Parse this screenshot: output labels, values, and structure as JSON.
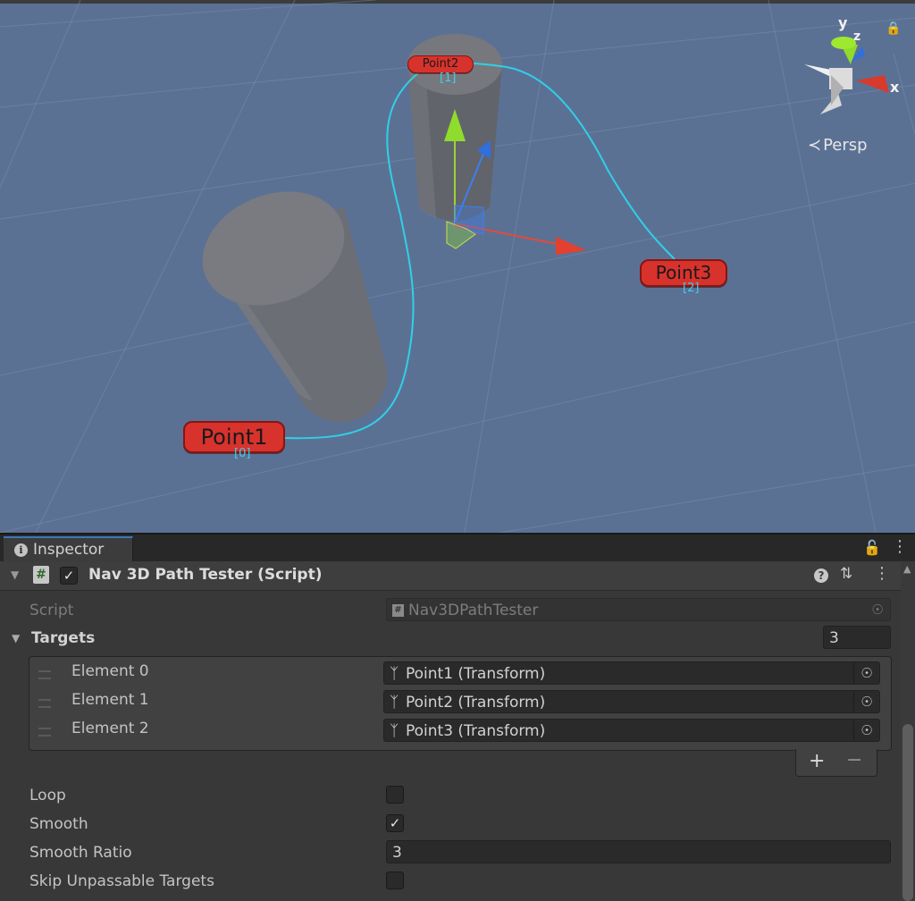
{
  "scene": {
    "points": [
      {
        "name": "Point1",
        "index": "[0]"
      },
      {
        "name": "Point2",
        "index": "[1]"
      },
      {
        "name": "Point3",
        "index": "[2]"
      }
    ],
    "gizmo": {
      "x": "x",
      "y": "y",
      "z": "z"
    },
    "projection": "Persp",
    "colors": {
      "path": "#2fd0e8",
      "label": "#d8322d",
      "background": "#5b7194"
    }
  },
  "inspector": {
    "tab_label": "Inspector",
    "component": {
      "title": "Nav 3D Path Tester (Script)",
      "enabled": true
    },
    "script": {
      "label": "Script",
      "value": "Nav3DPathTester"
    },
    "targets": {
      "label": "Targets",
      "size": "3",
      "elements": [
        {
          "label": "Element 0",
          "value": "Point1 (Transform)"
        },
        {
          "label": "Element 1",
          "value": "Point2 (Transform)"
        },
        {
          "label": "Element 2",
          "value": "Point3 (Transform)"
        }
      ],
      "add_label": "+",
      "remove_label": "−"
    },
    "loop": {
      "label": "Loop",
      "checked": false
    },
    "smooth": {
      "label": "Smooth",
      "checked": true
    },
    "smooth_ratio": {
      "label": "Smooth Ratio",
      "value": "3"
    },
    "skip_unpassable": {
      "label": "Skip Unpassable Targets",
      "checked": false
    }
  }
}
